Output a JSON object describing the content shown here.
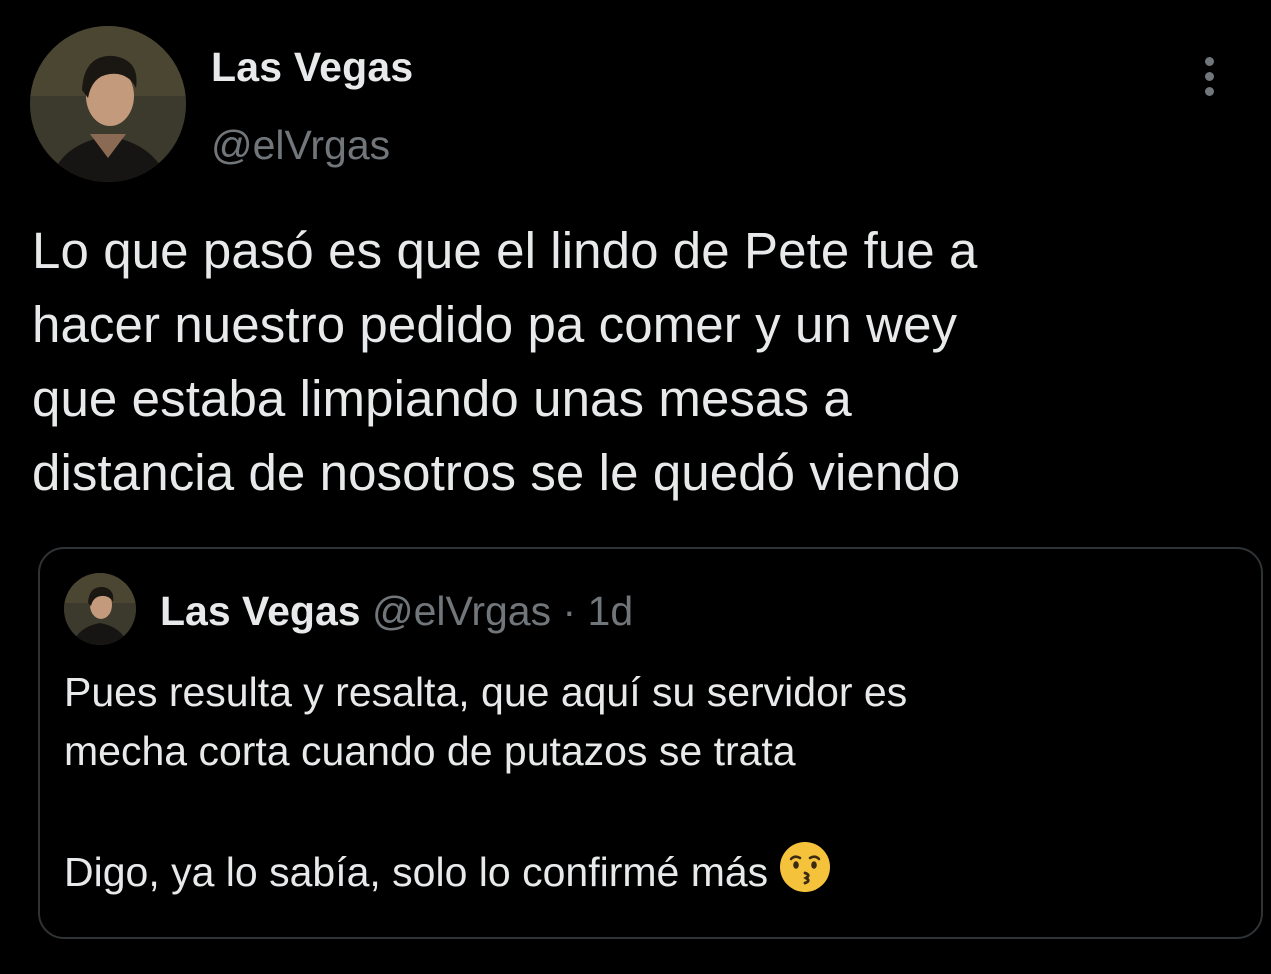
{
  "tweet": {
    "author_name": "Las Vegas",
    "author_handle": "@elVrgas",
    "more_icon": "more-vertical-icon",
    "text": "Lo que pasó es que el lindo de Pete fue a\nhacer nuestro pedido pa comer y un wey\nque estaba limpiando unas mesas a\ndistancia de nosotros se le quedó viendo"
  },
  "quote": {
    "author_name": "Las Vegas",
    "author_handle": "@elVrgas",
    "separator": " · ",
    "time": "1d",
    "text_part1": "Pues resulta y resalta, que aquí su servidor es\nmecha corta cuando de putazos se trata",
    "text_part2": "Digo, ya lo sabía, solo lo confirmé más",
    "emoji": "kissing-face-icon"
  },
  "colors": {
    "background": "#000000",
    "primary_text": "#e7e9ea",
    "secondary_text": "#71767b",
    "border": "#2f3336",
    "emoji_yellow": "#f5c33b"
  }
}
